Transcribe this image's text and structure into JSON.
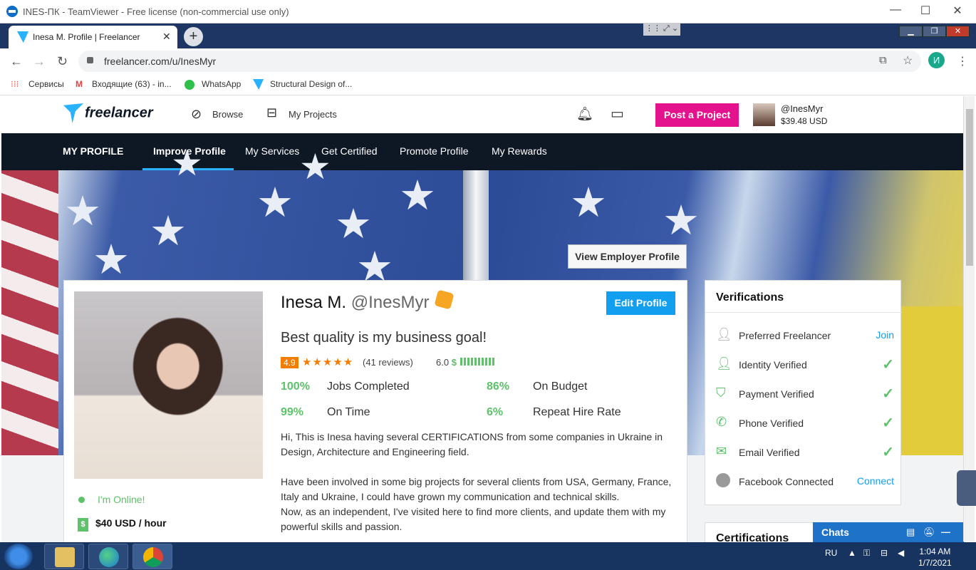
{
  "teamviewer": {
    "title": "INES-ПК - TeamViewer - Free license (non-commercial use only)"
  },
  "browser": {
    "tab_title": "Inesa M. Profile | Freelancer",
    "url": "freelancer.com/u/InesMyr",
    "profile_initial": "И"
  },
  "bookmarks": [
    {
      "label": "Сервисы"
    },
    {
      "label": "Входящие (63) - in..."
    },
    {
      "label": "WhatsApp"
    },
    {
      "label": "Structural Design of..."
    }
  ],
  "header": {
    "logo": "freelancer",
    "browse": "Browse",
    "my_projects": "My Projects",
    "post_project": "Post a Project",
    "username": "@InesMyr",
    "balance": "$39.48 USD"
  },
  "subnav": {
    "my_profile": "MY PROFILE",
    "items": [
      "Improve Profile",
      "My Services",
      "Get Certified",
      "Promote Profile",
      "My Rewards"
    ]
  },
  "banner": {
    "view_employer": "View Employer Profile"
  },
  "profile": {
    "name": "Inesa M.",
    "handle": "@InesMyr",
    "edit": "Edit Profile",
    "tagline": "Best quality is my business goal!",
    "rating": "4.9",
    "stars": "★★★★★",
    "reviews": "(41 reviews)",
    "score": "6.0",
    "score_symbol": "$",
    "stats": [
      {
        "pct": "100%",
        "label": "Jobs Completed"
      },
      {
        "pct": "86%",
        "label": "On Budget"
      },
      {
        "pct": "99%",
        "label": "On Time"
      },
      {
        "pct": "6%",
        "label": "Repeat Hire Rate"
      }
    ],
    "bio": [
      "Hi, This is Inesa having several CERTIFICATIONS from some companies in Ukraine in Design, Architecture and Engineering field.",
      "Have been involved in some big projects for several clients from USA, Germany, France, Italy and Ukraine, I could have grown my communication and technical skills.",
      "Now, as an independent, I've visited here to find more clients, and update them with my powerful skills and passion."
    ],
    "online": "I'm Online!",
    "hourly": "$40 USD / hour",
    "hourly_icon": "$"
  },
  "verifications": {
    "title": "Verifications",
    "rows": [
      {
        "label": "Preferred Freelancer",
        "action": "Join",
        "icon": "star-user-icon"
      },
      {
        "label": "Identity Verified",
        "action": "✓",
        "icon": "user-icon"
      },
      {
        "label": "Payment Verified",
        "action": "✓",
        "icon": "shield-dollar-icon"
      },
      {
        "label": "Phone Verified",
        "action": "✓",
        "icon": "phone-icon"
      },
      {
        "label": "Email Verified",
        "action": "✓",
        "icon": "mail-icon"
      },
      {
        "label": "Facebook Connected",
        "action": "Connect",
        "icon": "facebook-icon"
      }
    ]
  },
  "certifications": {
    "title": "Certifications"
  },
  "chats": {
    "label": "Chats"
  },
  "taskbar": {
    "lang": "RU",
    "time": "1:04 AM",
    "date": "1/7/2021"
  }
}
